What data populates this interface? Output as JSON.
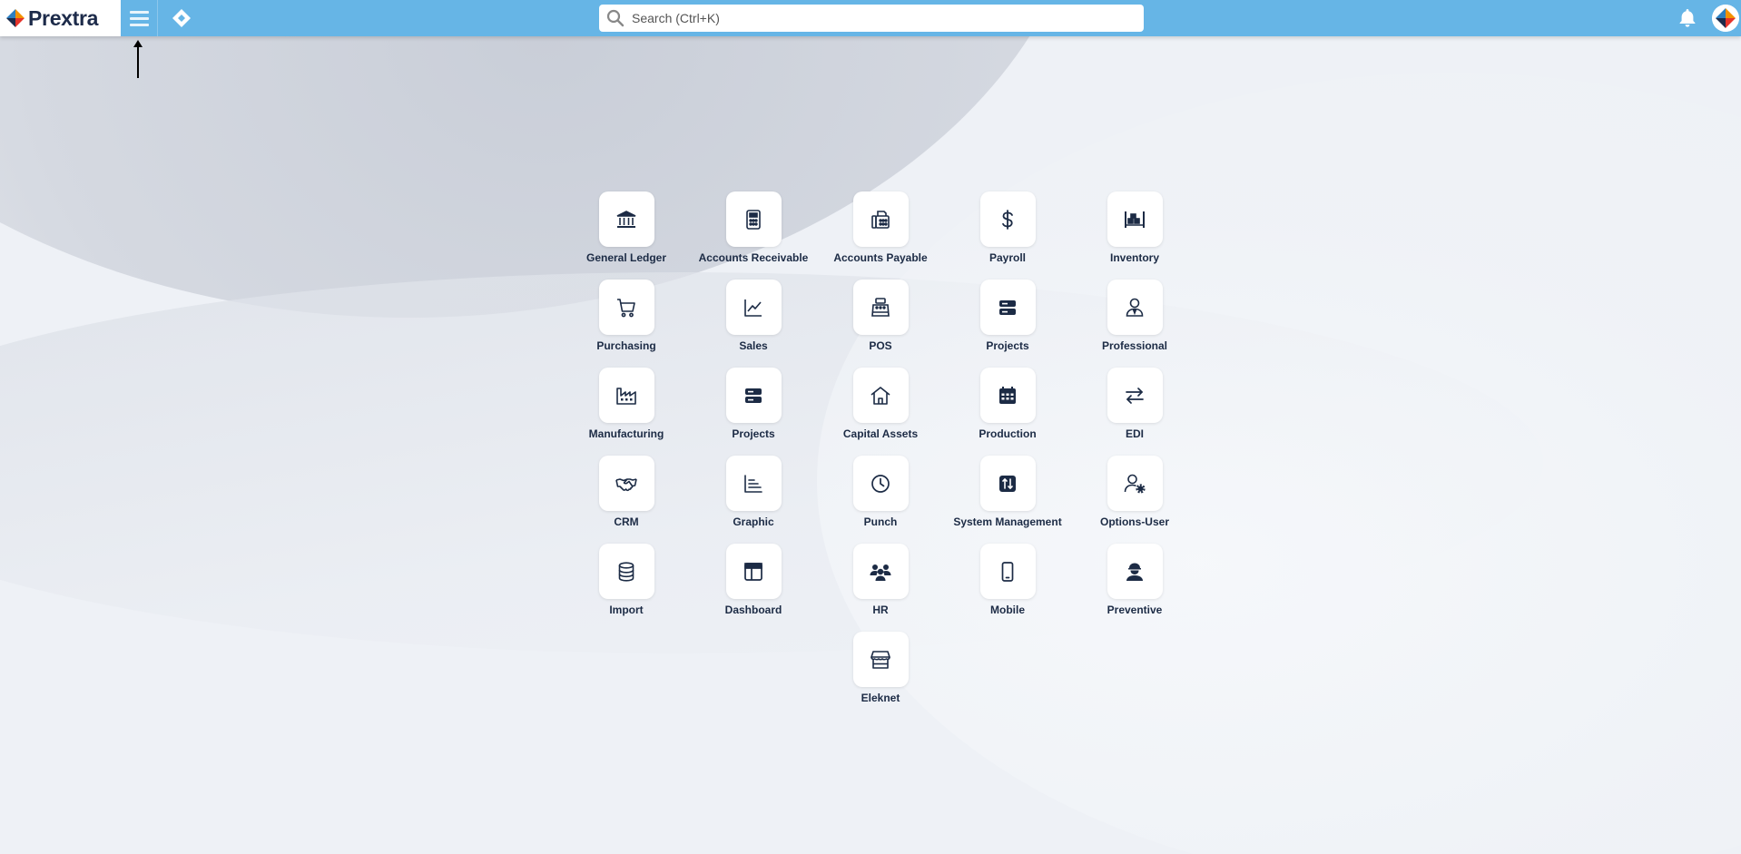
{
  "brand": {
    "logo_text": "Prextra",
    "colors": {
      "topbar": "#66b5e6",
      "icon": "#1c2b45"
    }
  },
  "header": {
    "search_placeholder": "Search (Ctrl+K)",
    "menu_icon": "hamburger-icon",
    "home_icon": "diamond-icon",
    "notifications_icon": "bell-icon"
  },
  "modules": [
    {
      "label": "General Ledger",
      "icon": "bank-icon"
    },
    {
      "label": "Accounts Receivable",
      "icon": "calculator-icon"
    },
    {
      "label": "Accounts Payable",
      "icon": "fax-icon"
    },
    {
      "label": "Payroll",
      "icon": "dollar-icon"
    },
    {
      "label": "Inventory",
      "icon": "warehouse-icon"
    },
    {
      "label": "Purchasing",
      "icon": "cart-icon"
    },
    {
      "label": "Sales",
      "icon": "line-chart-icon"
    },
    {
      "label": "POS",
      "icon": "cash-register-icon"
    },
    {
      "label": "Projects",
      "icon": "server-icon"
    },
    {
      "label": "Professional",
      "icon": "user-tie-icon"
    },
    {
      "label": "Manufacturing",
      "icon": "factory-icon"
    },
    {
      "label": "Projects",
      "icon": "server-icon"
    },
    {
      "label": "Capital Assets",
      "icon": "house-icon"
    },
    {
      "label": "Production",
      "icon": "calendar-icon"
    },
    {
      "label": "EDI",
      "icon": "swap-icon"
    },
    {
      "label": "CRM",
      "icon": "handshake-icon"
    },
    {
      "label": "Graphic",
      "icon": "bar-chart-icon"
    },
    {
      "label": "Punch",
      "icon": "clock-icon"
    },
    {
      "label": "System Management",
      "icon": "sliders-icon"
    },
    {
      "label": "Options-User",
      "icon": "user-gear-icon"
    },
    {
      "label": "Import",
      "icon": "database-icon"
    },
    {
      "label": "Dashboard",
      "icon": "layout-icon"
    },
    {
      "label": "HR",
      "icon": "users-icon"
    },
    {
      "label": "Mobile",
      "icon": "mobile-icon"
    },
    {
      "label": "Preventive",
      "icon": "worker-icon"
    },
    {
      "label": "Eleknet",
      "icon": "store-icon"
    }
  ]
}
